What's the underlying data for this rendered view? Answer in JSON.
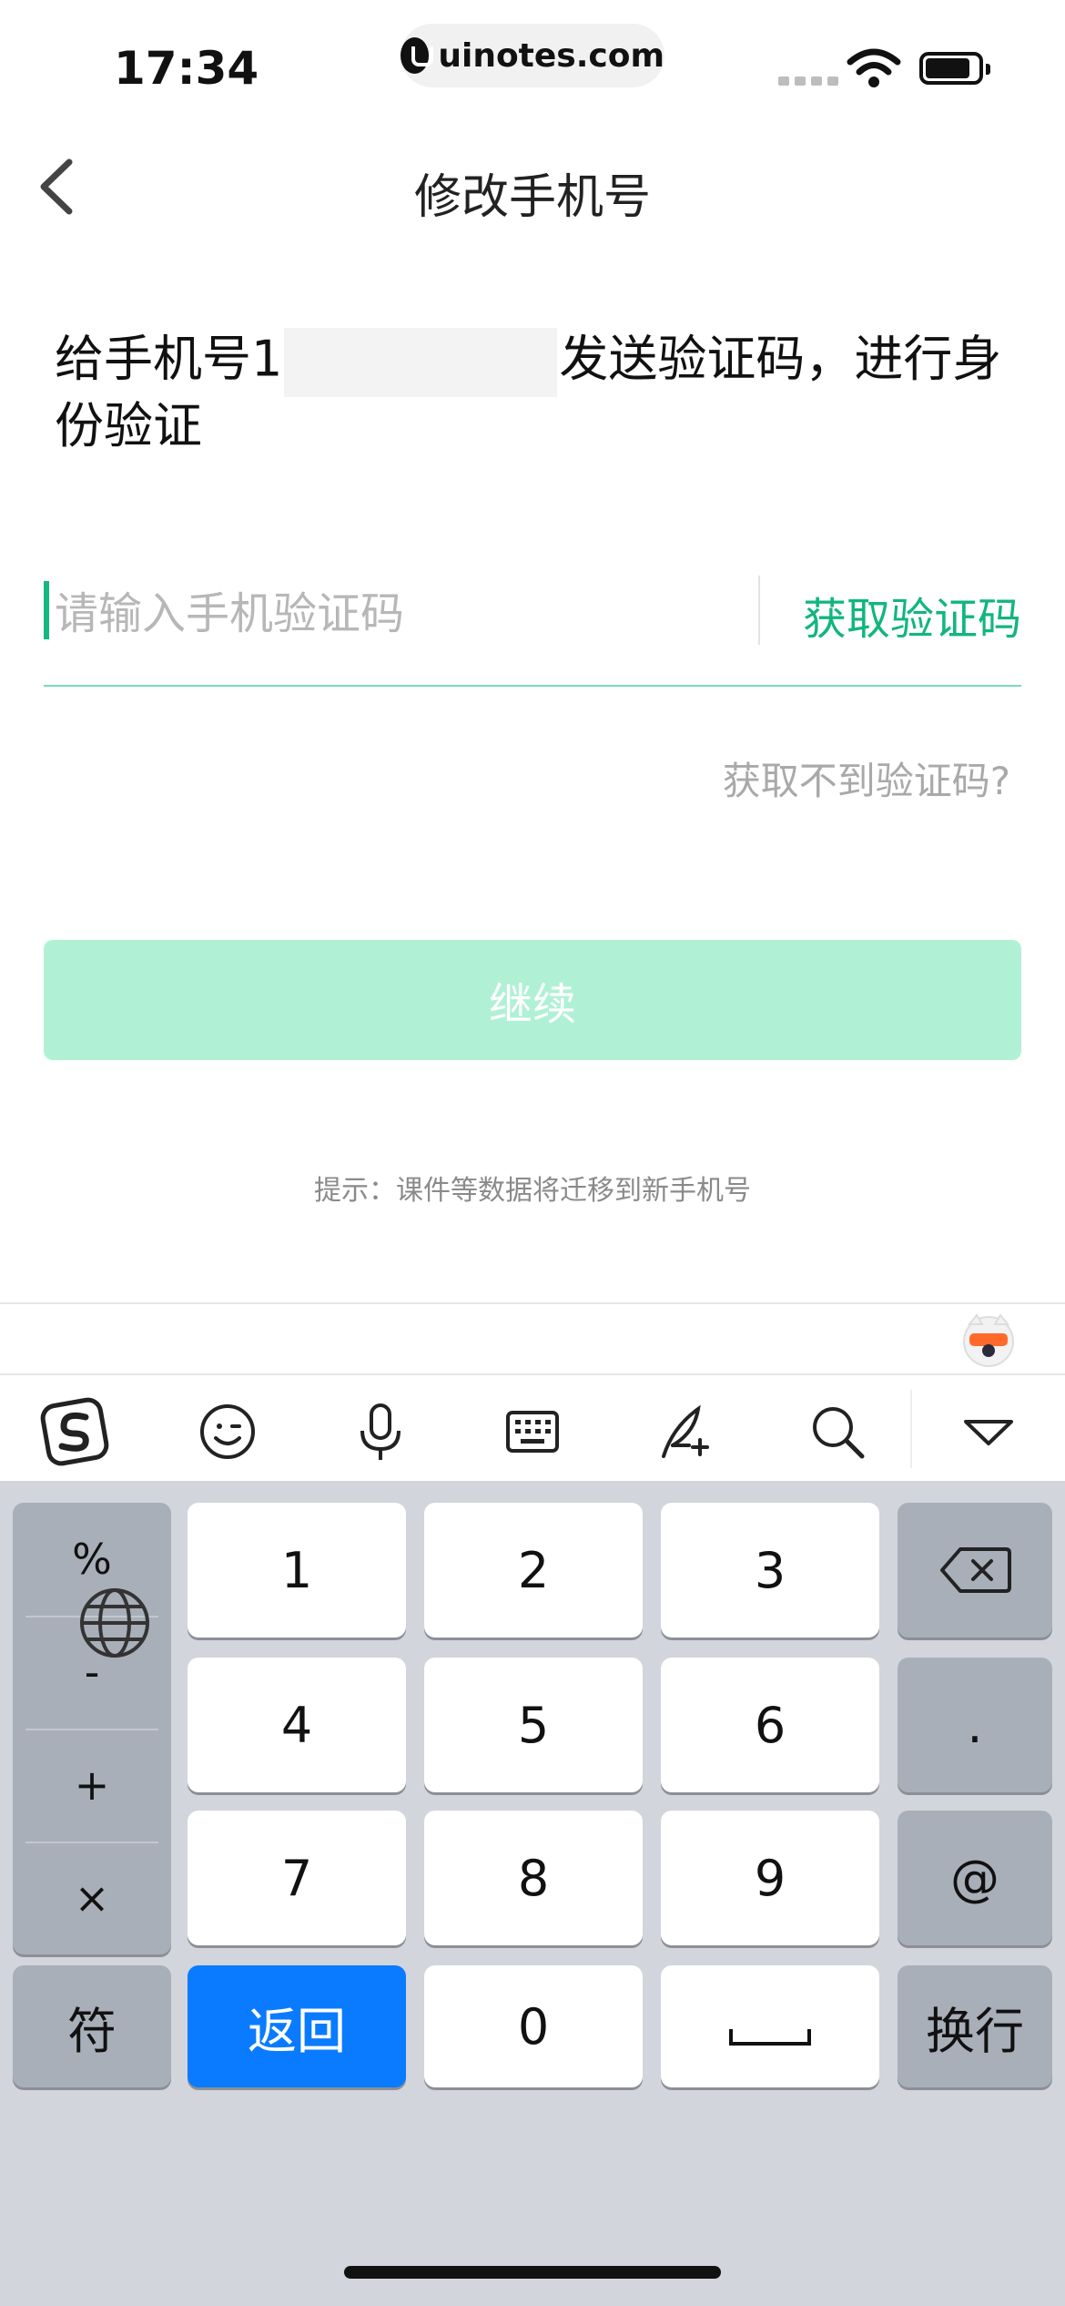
{
  "status_bar": {
    "time": "17:34",
    "url": "uinotes.com"
  },
  "nav": {
    "title": "修改手机号"
  },
  "message": {
    "prefix": "给手机号1",
    "suffix": "发送验证码，进行身份验证"
  },
  "input": {
    "placeholder": "请输入手机验证码",
    "value": "",
    "get_code_label": "获取验证码"
  },
  "help": {
    "label": "获取不到验证码?"
  },
  "continue_button": {
    "label": "继续"
  },
  "tip": {
    "text": "提示：课件等数据将迁移到新手机号"
  },
  "keyboard": {
    "toolbar_icons": [
      "sogou-logo-icon",
      "emoji-icon",
      "microphone-icon",
      "keyboard-icon",
      "quill-icon",
      "search-icon",
      "collapse-icon"
    ],
    "symbols": [
      "%",
      "-",
      "+",
      "×"
    ],
    "digits": [
      "1",
      "2",
      "3",
      "4",
      "5",
      "6",
      "7",
      "8",
      "9",
      "0"
    ],
    "period": ".",
    "at": "@",
    "fu_label": "符",
    "return_label": "返回",
    "newline_label": "换行"
  },
  "colors": {
    "accent": "#11b67c",
    "button_disabled": "#b0f1d5",
    "return_key": "#0a7bff"
  }
}
